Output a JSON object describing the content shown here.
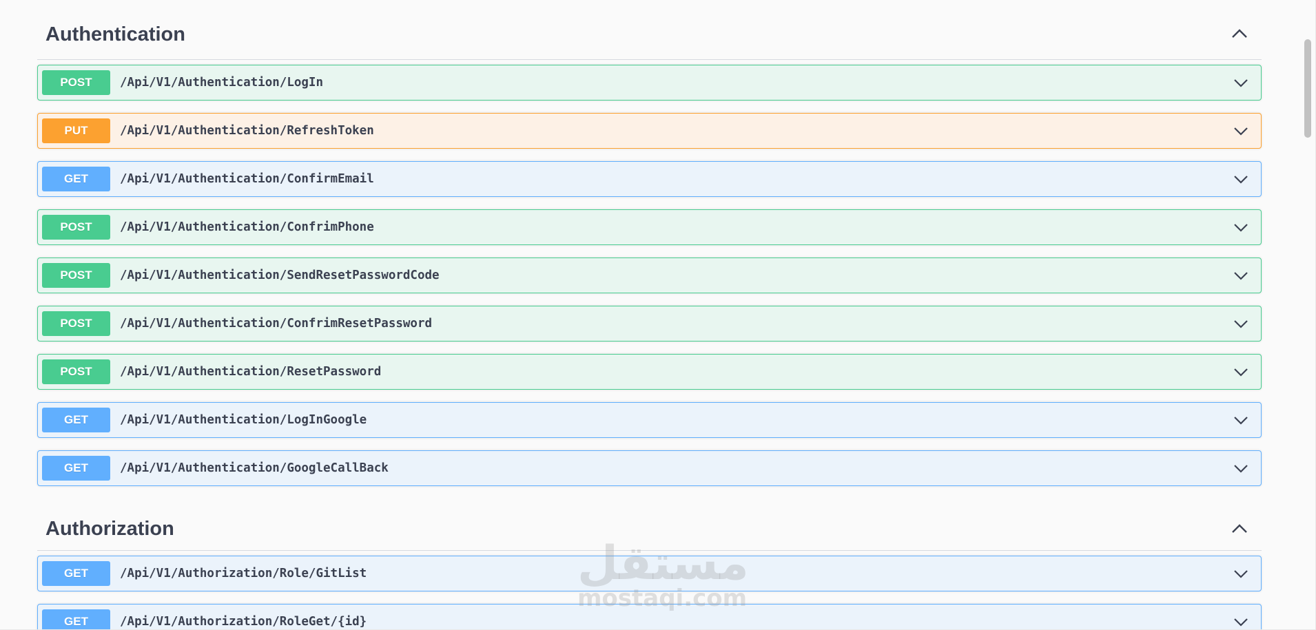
{
  "sections": [
    {
      "title": "Authentication",
      "operations": [
        {
          "method": "POST",
          "path": "/Api/V1/Authentication/LogIn"
        },
        {
          "method": "PUT",
          "path": "/Api/V1/Authentication/RefreshToken"
        },
        {
          "method": "GET",
          "path": "/Api/V1/Authentication/ConfirmEmail"
        },
        {
          "method": "POST",
          "path": "/Api/V1/Authentication/ConfrimPhone"
        },
        {
          "method": "POST",
          "path": "/Api/V1/Authentication/SendResetPasswordCode"
        },
        {
          "method": "POST",
          "path": "/Api/V1/Authentication/ConfrimResetPassword"
        },
        {
          "method": "POST",
          "path": "/Api/V1/Authentication/ResetPassword"
        },
        {
          "method": "GET",
          "path": "/Api/V1/Authentication/LogInGoogle"
        },
        {
          "method": "GET",
          "path": "/Api/V1/Authentication/GoogleCallBack"
        }
      ]
    },
    {
      "title": "Authorization",
      "operations": [
        {
          "method": "GET",
          "path": "/Api/V1/Authorization/Role/GitList"
        },
        {
          "method": "GET",
          "path": "/Api/V1/Authorization/RoleGet/{id}"
        }
      ]
    }
  ],
  "watermark": {
    "arabic": "مستقل",
    "latin": "mostaqi.com"
  },
  "colors": {
    "post": "#49cc90",
    "put": "#fca130",
    "get": "#61affe",
    "text": "#3b4151"
  },
  "icons": {
    "section_toggle": "chevron-up-icon",
    "operation_toggle": "chevron-down-icon"
  }
}
